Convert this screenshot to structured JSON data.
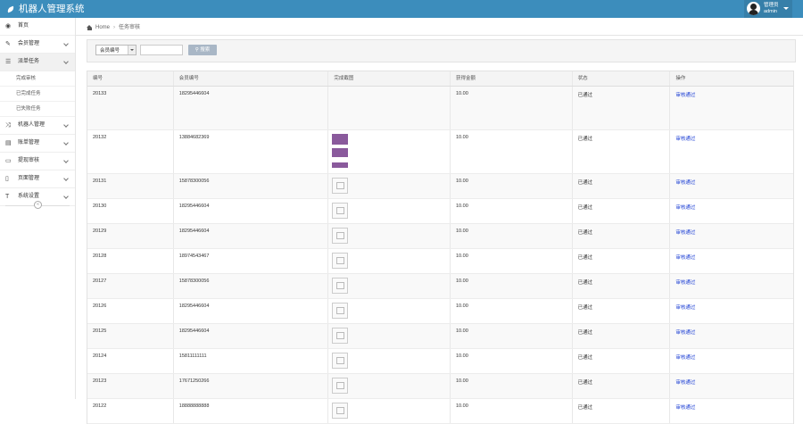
{
  "app": {
    "title": "机器人管理系统"
  },
  "user": {
    "name": "管理员",
    "role": "admin"
  },
  "sidebar": {
    "items": [
      {
        "label": "首页",
        "icon": "dashboard-icon"
      },
      {
        "label": "会员管理",
        "icon": "edit-icon"
      },
      {
        "label": "派单任务",
        "icon": "list-icon",
        "open": true
      },
      {
        "label": "机器人管理",
        "icon": "shuffle-icon"
      },
      {
        "label": "账单管理",
        "icon": "book-icon"
      },
      {
        "label": "提现审核",
        "icon": "card-icon"
      },
      {
        "label": "页面管理",
        "icon": "file-icon"
      },
      {
        "label": "系统设置",
        "icon": "text-icon"
      }
    ],
    "sub_items": [
      "完成审核",
      "已完成任务",
      "已失败任务"
    ]
  },
  "breadcrumb": {
    "home": "Home",
    "current": "任务审核"
  },
  "search": {
    "select_value": "会员编号",
    "input_value": "",
    "button_label": "搜索"
  },
  "table": {
    "headers": [
      "编号",
      "会员编号",
      "完成截图",
      "获得金额",
      "状态",
      "操作"
    ],
    "rows": [
      {
        "id": "20133",
        "member": "18295446604",
        "amount": "10.00",
        "status": "已通过",
        "action": "审核通过",
        "img": "none"
      },
      {
        "id": "20132",
        "member": "13884682369",
        "amount": "10.00",
        "status": "已通过",
        "action": "审核通过",
        "img": "photo"
      },
      {
        "id": "20131",
        "member": "15878300056",
        "amount": "10.00",
        "status": "已通过",
        "action": "审核通过",
        "img": "thumb"
      },
      {
        "id": "20130",
        "member": "18295446604",
        "amount": "10.00",
        "status": "已通过",
        "action": "审核通过",
        "img": "thumb"
      },
      {
        "id": "20129",
        "member": "18295446604",
        "amount": "10.00",
        "status": "已通过",
        "action": "审核通过",
        "img": "thumb"
      },
      {
        "id": "20128",
        "member": "18974543467",
        "amount": "10.00",
        "status": "已通过",
        "action": "审核通过",
        "img": "thumb"
      },
      {
        "id": "20127",
        "member": "15878300056",
        "amount": "10.00",
        "status": "已通过",
        "action": "审核通过",
        "img": "thumb"
      },
      {
        "id": "20126",
        "member": "18295446604",
        "amount": "10.00",
        "status": "已通过",
        "action": "审核通过",
        "img": "thumb"
      },
      {
        "id": "20125",
        "member": "18295446604",
        "amount": "10.00",
        "status": "已通过",
        "action": "审核通过",
        "img": "thumb"
      },
      {
        "id": "20124",
        "member": "15811111111",
        "amount": "10.00",
        "status": "已通过",
        "action": "审核通过",
        "img": "thumb"
      },
      {
        "id": "20123",
        "member": "17671250266",
        "amount": "10.00",
        "status": "已通过",
        "action": "审核通过",
        "img": "thumb"
      },
      {
        "id": "20122",
        "member": "18888888888",
        "amount": "10.00",
        "status": "已通过",
        "action": "审核通过",
        "img": "thumb"
      }
    ]
  },
  "colors": {
    "topbar": "#3c8dbc",
    "link": "#1a3dd4",
    "button": "#a9b7c6"
  }
}
